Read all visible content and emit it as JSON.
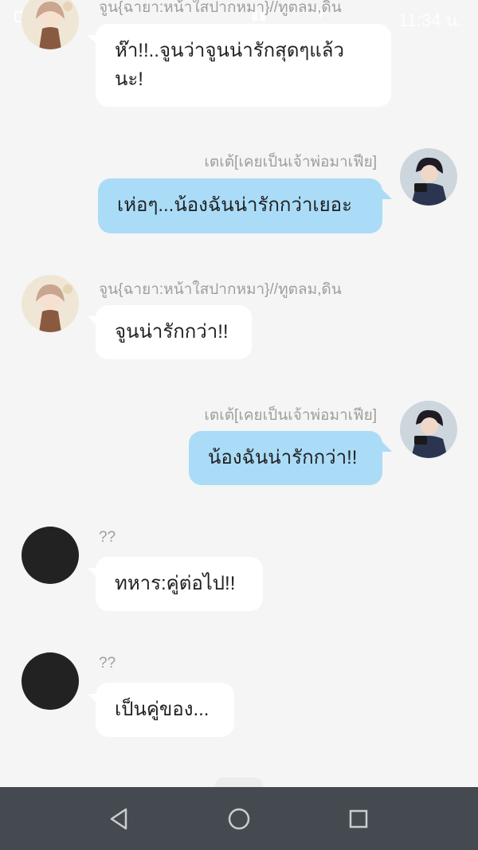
{
  "status_bar": {
    "time": "11:34 น."
  },
  "messages": [
    {
      "side": "left",
      "sender": "จูน{ฉายา:หน้าใสปากหมา}//ทูตลม,ดิน",
      "lines": [
        "ห๊า!!..จูนว่าจูนน่ารักสุดๆแล้ว",
        "นะ!"
      ],
      "avatar": "girl-avatar"
    },
    {
      "side": "right",
      "sender": "เตเต้[เคยเป็นเจ้าพ่อมาเฟีย]",
      "lines": [
        "เห่อๆ...น้องฉันน่ารักกว่าเยอะ"
      ],
      "avatar": "boy-avatar"
    },
    {
      "side": "left",
      "sender": "จูน{ฉายา:หน้าใสปากหมา}//ทูตลม,ดิน",
      "lines": [
        "จูนน่ารักกว่า!!"
      ],
      "avatar": "girl-avatar"
    },
    {
      "side": "right",
      "sender": "เตเต้[เคยเป็นเจ้าพ่อมาเฟีย]",
      "lines": [
        "น้องฉันน่ารักกว่า!!"
      ],
      "avatar": "boy-avatar"
    },
    {
      "side": "left",
      "sender": "??",
      "lines": [
        "ทหาร:คู่ต่อไป!!"
      ],
      "avatar": "unknown-avatar"
    },
    {
      "side": "left",
      "sender": "??",
      "lines": [
        "เป็นคู่ของ..."
      ],
      "avatar": "unknown-avatar"
    }
  ],
  "navbar": {
    "back": "back-icon",
    "home": "home-icon",
    "recents": "recents-icon"
  },
  "colors": {
    "background": "#f5f5f5",
    "bubble_left": "#ffffff",
    "bubble_right": "#aadcf8",
    "name_text": "#9e9e9e",
    "navbar": "#454a50"
  }
}
